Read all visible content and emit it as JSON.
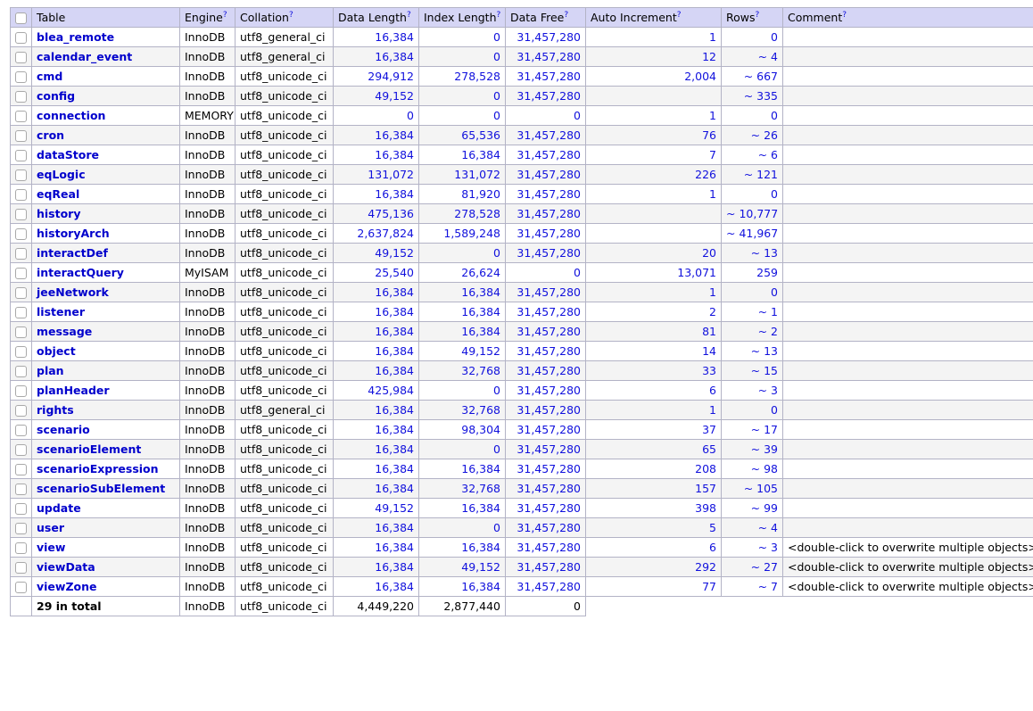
{
  "table": {
    "columns": [
      {
        "key": "check",
        "label": "",
        "hint": false
      },
      {
        "key": "name",
        "label": "Table",
        "hint": false
      },
      {
        "key": "engine",
        "label": "Engine",
        "hint": true
      },
      {
        "key": "collation",
        "label": "Collation",
        "hint": true
      },
      {
        "key": "data_len",
        "label": "Data Length",
        "hint": true
      },
      {
        "key": "index_len",
        "label": "Index Length",
        "hint": true
      },
      {
        "key": "data_free",
        "label": "Data Free",
        "hint": true
      },
      {
        "key": "auto_inc",
        "label": "Auto Increment",
        "hint": true
      },
      {
        "key": "rows",
        "label": "Rows",
        "hint": true
      },
      {
        "key": "comment",
        "label": "Comment",
        "hint": true
      }
    ],
    "hint_marker": "?",
    "rows": [
      {
        "name": "blea_remote",
        "engine": "InnoDB",
        "collation": "utf8_general_ci",
        "data_len": "16,384",
        "index_len": "0",
        "data_free": "31,457,280",
        "auto_inc": "1",
        "rows": "0",
        "comment": ""
      },
      {
        "name": "calendar_event",
        "engine": "InnoDB",
        "collation": "utf8_general_ci",
        "data_len": "16,384",
        "index_len": "0",
        "data_free": "31,457,280",
        "auto_inc": "12",
        "rows": "~ 4",
        "comment": ""
      },
      {
        "name": "cmd",
        "engine": "InnoDB",
        "collation": "utf8_unicode_ci",
        "data_len": "294,912",
        "index_len": "278,528",
        "data_free": "31,457,280",
        "auto_inc": "2,004",
        "rows": "~ 667",
        "comment": ""
      },
      {
        "name": "config",
        "engine": "InnoDB",
        "collation": "utf8_unicode_ci",
        "data_len": "49,152",
        "index_len": "0",
        "data_free": "31,457,280",
        "auto_inc": "",
        "rows": "~ 335",
        "comment": ""
      },
      {
        "name": "connection",
        "engine": "MEMORY",
        "collation": "utf8_unicode_ci",
        "data_len": "0",
        "index_len": "0",
        "data_free": "0",
        "auto_inc": "1",
        "rows": "0",
        "comment": ""
      },
      {
        "name": "cron",
        "engine": "InnoDB",
        "collation": "utf8_unicode_ci",
        "data_len": "16,384",
        "index_len": "65,536",
        "data_free": "31,457,280",
        "auto_inc": "76",
        "rows": "~ 26",
        "comment": ""
      },
      {
        "name": "dataStore",
        "engine": "InnoDB",
        "collation": "utf8_unicode_ci",
        "data_len": "16,384",
        "index_len": "16,384",
        "data_free": "31,457,280",
        "auto_inc": "7",
        "rows": "~ 6",
        "comment": ""
      },
      {
        "name": "eqLogic",
        "engine": "InnoDB",
        "collation": "utf8_unicode_ci",
        "data_len": "131,072",
        "index_len": "131,072",
        "data_free": "31,457,280",
        "auto_inc": "226",
        "rows": "~ 121",
        "comment": ""
      },
      {
        "name": "eqReal",
        "engine": "InnoDB",
        "collation": "utf8_unicode_ci",
        "data_len": "16,384",
        "index_len": "81,920",
        "data_free": "31,457,280",
        "auto_inc": "1",
        "rows": "0",
        "comment": ""
      },
      {
        "name": "history",
        "engine": "InnoDB",
        "collation": "utf8_unicode_ci",
        "data_len": "475,136",
        "index_len": "278,528",
        "data_free": "31,457,280",
        "auto_inc": "",
        "rows": "~ 10,777",
        "comment": ""
      },
      {
        "name": "historyArch",
        "engine": "InnoDB",
        "collation": "utf8_unicode_ci",
        "data_len": "2,637,824",
        "index_len": "1,589,248",
        "data_free": "31,457,280",
        "auto_inc": "",
        "rows": "~ 41,967",
        "comment": ""
      },
      {
        "name": "interactDef",
        "engine": "InnoDB",
        "collation": "utf8_unicode_ci",
        "data_len": "49,152",
        "index_len": "0",
        "data_free": "31,457,280",
        "auto_inc": "20",
        "rows": "~ 13",
        "comment": ""
      },
      {
        "name": "interactQuery",
        "engine": "MyISAM",
        "collation": "utf8_unicode_ci",
        "data_len": "25,540",
        "index_len": "26,624",
        "data_free": "0",
        "auto_inc": "13,071",
        "rows": "259",
        "comment": ""
      },
      {
        "name": "jeeNetwork",
        "engine": "InnoDB",
        "collation": "utf8_unicode_ci",
        "data_len": "16,384",
        "index_len": "16,384",
        "data_free": "31,457,280",
        "auto_inc": "1",
        "rows": "0",
        "comment": ""
      },
      {
        "name": "listener",
        "engine": "InnoDB",
        "collation": "utf8_unicode_ci",
        "data_len": "16,384",
        "index_len": "16,384",
        "data_free": "31,457,280",
        "auto_inc": "2",
        "rows": "~ 1",
        "comment": ""
      },
      {
        "name": "message",
        "engine": "InnoDB",
        "collation": "utf8_unicode_ci",
        "data_len": "16,384",
        "index_len": "16,384",
        "data_free": "31,457,280",
        "auto_inc": "81",
        "rows": "~ 2",
        "comment": ""
      },
      {
        "name": "object",
        "engine": "InnoDB",
        "collation": "utf8_unicode_ci",
        "data_len": "16,384",
        "index_len": "49,152",
        "data_free": "31,457,280",
        "auto_inc": "14",
        "rows": "~ 13",
        "comment": ""
      },
      {
        "name": "plan",
        "engine": "InnoDB",
        "collation": "utf8_unicode_ci",
        "data_len": "16,384",
        "index_len": "32,768",
        "data_free": "31,457,280",
        "auto_inc": "33",
        "rows": "~ 15",
        "comment": ""
      },
      {
        "name": "planHeader",
        "engine": "InnoDB",
        "collation": "utf8_unicode_ci",
        "data_len": "425,984",
        "index_len": "0",
        "data_free": "31,457,280",
        "auto_inc": "6",
        "rows": "~ 3",
        "comment": ""
      },
      {
        "name": "rights",
        "engine": "InnoDB",
        "collation": "utf8_general_ci",
        "data_len": "16,384",
        "index_len": "32,768",
        "data_free": "31,457,280",
        "auto_inc": "1",
        "rows": "0",
        "comment": ""
      },
      {
        "name": "scenario",
        "engine": "InnoDB",
        "collation": "utf8_unicode_ci",
        "data_len": "16,384",
        "index_len": "98,304",
        "data_free": "31,457,280",
        "auto_inc": "37",
        "rows": "~ 17",
        "comment": ""
      },
      {
        "name": "scenarioElement",
        "engine": "InnoDB",
        "collation": "utf8_unicode_ci",
        "data_len": "16,384",
        "index_len": "0",
        "data_free": "31,457,280",
        "auto_inc": "65",
        "rows": "~ 39",
        "comment": ""
      },
      {
        "name": "scenarioExpression",
        "engine": "InnoDB",
        "collation": "utf8_unicode_ci",
        "data_len": "16,384",
        "index_len": "16,384",
        "data_free": "31,457,280",
        "auto_inc": "208",
        "rows": "~ 98",
        "comment": ""
      },
      {
        "name": "scenarioSubElement",
        "engine": "InnoDB",
        "collation": "utf8_unicode_ci",
        "data_len": "16,384",
        "index_len": "32,768",
        "data_free": "31,457,280",
        "auto_inc": "157",
        "rows": "~ 105",
        "comment": ""
      },
      {
        "name": "update",
        "engine": "InnoDB",
        "collation": "utf8_unicode_ci",
        "data_len": "49,152",
        "index_len": "16,384",
        "data_free": "31,457,280",
        "auto_inc": "398",
        "rows": "~ 99",
        "comment": ""
      },
      {
        "name": "user",
        "engine": "InnoDB",
        "collation": "utf8_unicode_ci",
        "data_len": "16,384",
        "index_len": "0",
        "data_free": "31,457,280",
        "auto_inc": "5",
        "rows": "~ 4",
        "comment": ""
      },
      {
        "name": "view",
        "engine": "InnoDB",
        "collation": "utf8_unicode_ci",
        "data_len": "16,384",
        "index_len": "16,384",
        "data_free": "31,457,280",
        "auto_inc": "6",
        "rows": "~ 3",
        "comment": "<double-click to overwrite multiple objects>"
      },
      {
        "name": "viewData",
        "engine": "InnoDB",
        "collation": "utf8_unicode_ci",
        "data_len": "16,384",
        "index_len": "49,152",
        "data_free": "31,457,280",
        "auto_inc": "292",
        "rows": "~ 27",
        "comment": "<double-click to overwrite multiple objects>"
      },
      {
        "name": "viewZone",
        "engine": "InnoDB",
        "collation": "utf8_unicode_ci",
        "data_len": "16,384",
        "index_len": "16,384",
        "data_free": "31,457,280",
        "auto_inc": "77",
        "rows": "~ 7",
        "comment": "<double-click to overwrite multiple objects>"
      }
    ],
    "total": {
      "name": "29 in total",
      "engine": "InnoDB",
      "collation": "utf8_unicode_ci",
      "data_len": "4,449,220",
      "index_len": "2,877,440",
      "data_free": "0"
    }
  }
}
